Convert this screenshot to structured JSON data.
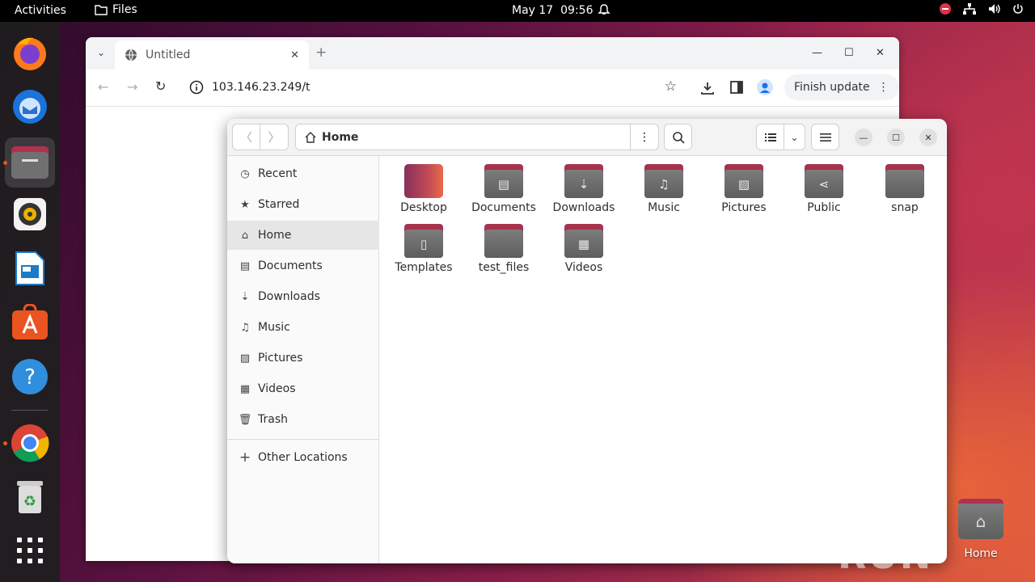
{
  "topbar": {
    "activities": "Activities",
    "app_name": "Files",
    "date": "May 17",
    "time": "09:56"
  },
  "dock": {
    "items": [
      "firefox-icon",
      "thunderbird-icon",
      "files-icon",
      "rhythmbox-icon",
      "writer-icon",
      "app-center-icon",
      "help-icon",
      "chrome-icon",
      "trash-icon",
      "apps-grid-icon"
    ]
  },
  "browser": {
    "tab_title": "Untitled",
    "url": "103.146.23.249/t",
    "finish_update": "Finish update"
  },
  "files": {
    "location": "Home",
    "sidebar": {
      "items": [
        {
          "label": "Recent",
          "icon": "clock-icon"
        },
        {
          "label": "Starred",
          "icon": "star-icon"
        },
        {
          "label": "Home",
          "icon": "home-icon"
        },
        {
          "label": "Documents",
          "icon": "document-icon"
        },
        {
          "label": "Downloads",
          "icon": "download-icon"
        },
        {
          "label": "Music",
          "icon": "music-icon"
        },
        {
          "label": "Pictures",
          "icon": "picture-icon"
        },
        {
          "label": "Videos",
          "icon": "video-icon"
        },
        {
          "label": "Trash",
          "icon": "trash-icon"
        }
      ],
      "other_locations": "Other Locations"
    },
    "folders": [
      {
        "label": "Desktop",
        "icon": "desktop-folder-icon"
      },
      {
        "label": "Documents",
        "icon": "documents-folder-icon"
      },
      {
        "label": "Downloads",
        "icon": "downloads-folder-icon"
      },
      {
        "label": "Music",
        "icon": "music-folder-icon"
      },
      {
        "label": "Pictures",
        "icon": "pictures-folder-icon"
      },
      {
        "label": "Public",
        "icon": "public-folder-icon"
      },
      {
        "label": "snap",
        "icon": "folder-icon"
      },
      {
        "label": "Templates",
        "icon": "templates-folder-icon"
      },
      {
        "label": "test_files",
        "icon": "folder-icon"
      },
      {
        "label": "Videos",
        "icon": "videos-folder-icon"
      }
    ]
  },
  "desktop": {
    "home_label": "Home",
    "watermark": "ANY RUN"
  },
  "colors": {
    "accent": "#e95420",
    "folder_tab": "#a8344e",
    "folder_body": "#6e6e6e"
  }
}
